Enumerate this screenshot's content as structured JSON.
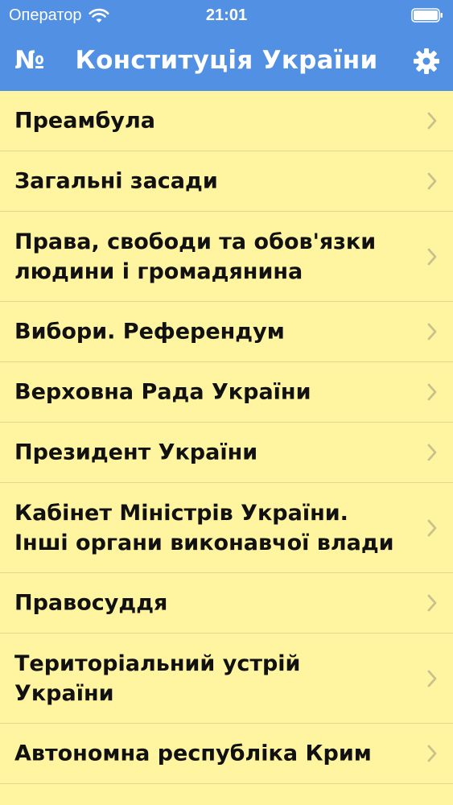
{
  "status_bar": {
    "carrier": "Оператор",
    "time": "21:01",
    "wifi_icon": "wifi-icon",
    "battery_icon": "battery-icon"
  },
  "nav": {
    "left_label": "№",
    "title": "Конституція України",
    "settings_icon": "gear-icon"
  },
  "sections": [
    {
      "label": "Преамбула"
    },
    {
      "label": "Загальні засади"
    },
    {
      "label": "Права, свободи та обов'язки\nлюдини і громадянина"
    },
    {
      "label": "Вибори. Референдум"
    },
    {
      "label": "Верховна Рада України"
    },
    {
      "label": "Президент України"
    },
    {
      "label": "Кабінет Міністрів України.\nІнші органи виконавчої влади"
    },
    {
      "label": "Правосуддя"
    },
    {
      "label": "Територіальний устрій\nУкраїни"
    },
    {
      "label": "Автономна республіка Крим"
    }
  ],
  "colors": {
    "header_bg": "#5290e4",
    "list_bg": "#fff4a0",
    "separator": "#e3d88a",
    "chevron": "#c9c18b"
  }
}
